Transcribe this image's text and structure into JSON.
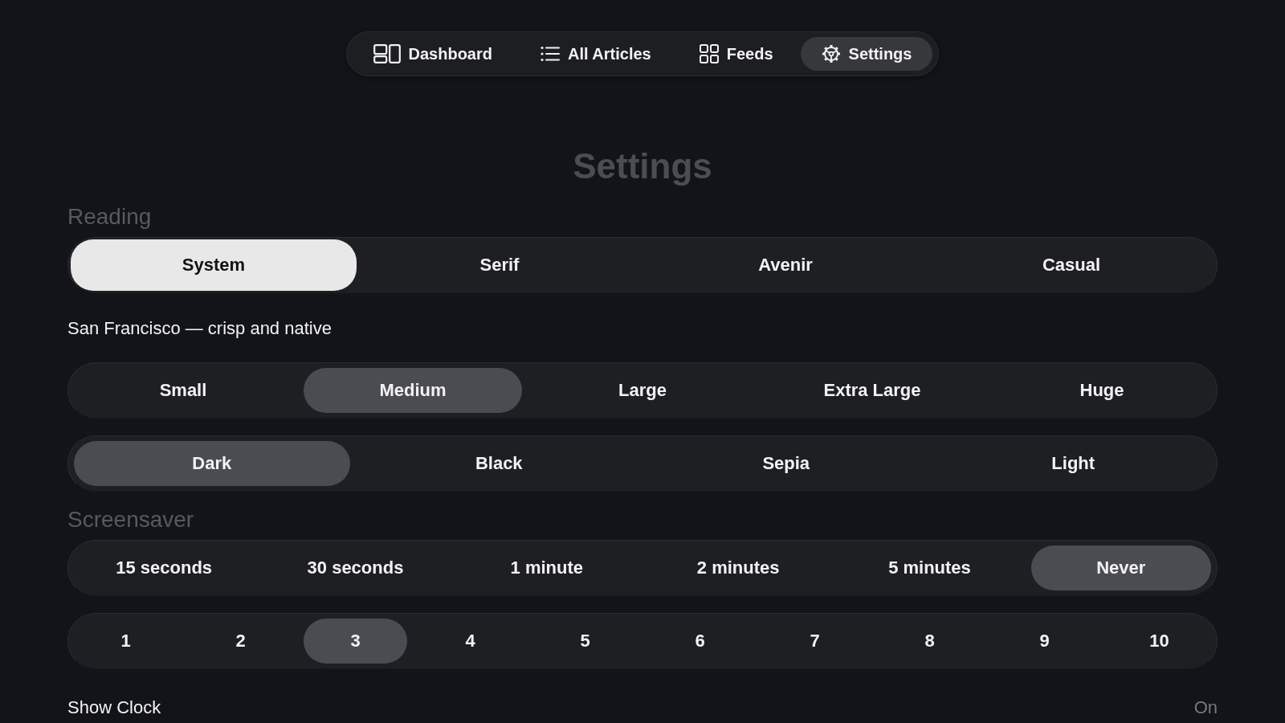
{
  "nav": {
    "items": [
      {
        "label": "Dashboard",
        "selected": false
      },
      {
        "label": "All Articles",
        "selected": false
      },
      {
        "label": "Feeds",
        "selected": false
      },
      {
        "label": "Settings",
        "selected": true
      }
    ]
  },
  "title": "Settings",
  "sections": [
    {
      "heading": "Reading",
      "controls": [
        {
          "kind": "picker",
          "options": [
            {
              "label": "System",
              "selected": true
            },
            {
              "label": "Serif",
              "selected": false
            },
            {
              "label": "Avenir",
              "selected": false
            },
            {
              "label": "Casual",
              "selected": false
            }
          ]
        },
        {
          "kind": "caption",
          "text": "San Francisco — crisp and native"
        },
        {
          "kind": "segmented",
          "options": [
            {
              "label": "Small",
              "selected": false
            },
            {
              "label": "Medium",
              "selected": true
            },
            {
              "label": "Large",
              "selected": false
            },
            {
              "label": "Extra Large",
              "selected": false
            },
            {
              "label": "Huge",
              "selected": false
            }
          ]
        },
        {
          "kind": "segmented",
          "options": [
            {
              "label": "Dark",
              "selected": true
            },
            {
              "label": "Black",
              "selected": false
            },
            {
              "label": "Sepia",
              "selected": false
            },
            {
              "label": "Light",
              "selected": false
            }
          ]
        }
      ]
    },
    {
      "heading": "Screensaver",
      "controls": [
        {
          "kind": "segmented",
          "options": [
            {
              "label": "15 seconds",
              "selected": false
            },
            {
              "label": "30 seconds",
              "selected": false
            },
            {
              "label": "1 minute",
              "selected": false
            },
            {
              "label": "2 minutes",
              "selected": false
            },
            {
              "label": "5 minutes",
              "selected": false
            },
            {
              "label": "Never",
              "selected": true
            }
          ]
        },
        {
          "kind": "segmented",
          "options": [
            {
              "label": "1",
              "selected": false
            },
            {
              "label": "2",
              "selected": false
            },
            {
              "label": "3",
              "selected": true
            },
            {
              "label": "4",
              "selected": false
            },
            {
              "label": "5",
              "selected": false
            },
            {
              "label": "6",
              "selected": false
            },
            {
              "label": "7",
              "selected": false
            },
            {
              "label": "8",
              "selected": false
            },
            {
              "label": "9",
              "selected": false
            },
            {
              "label": "10",
              "selected": false
            }
          ]
        },
        {
          "kind": "setting",
          "label": "Show Clock",
          "value": "On"
        }
      ]
    }
  ]
}
